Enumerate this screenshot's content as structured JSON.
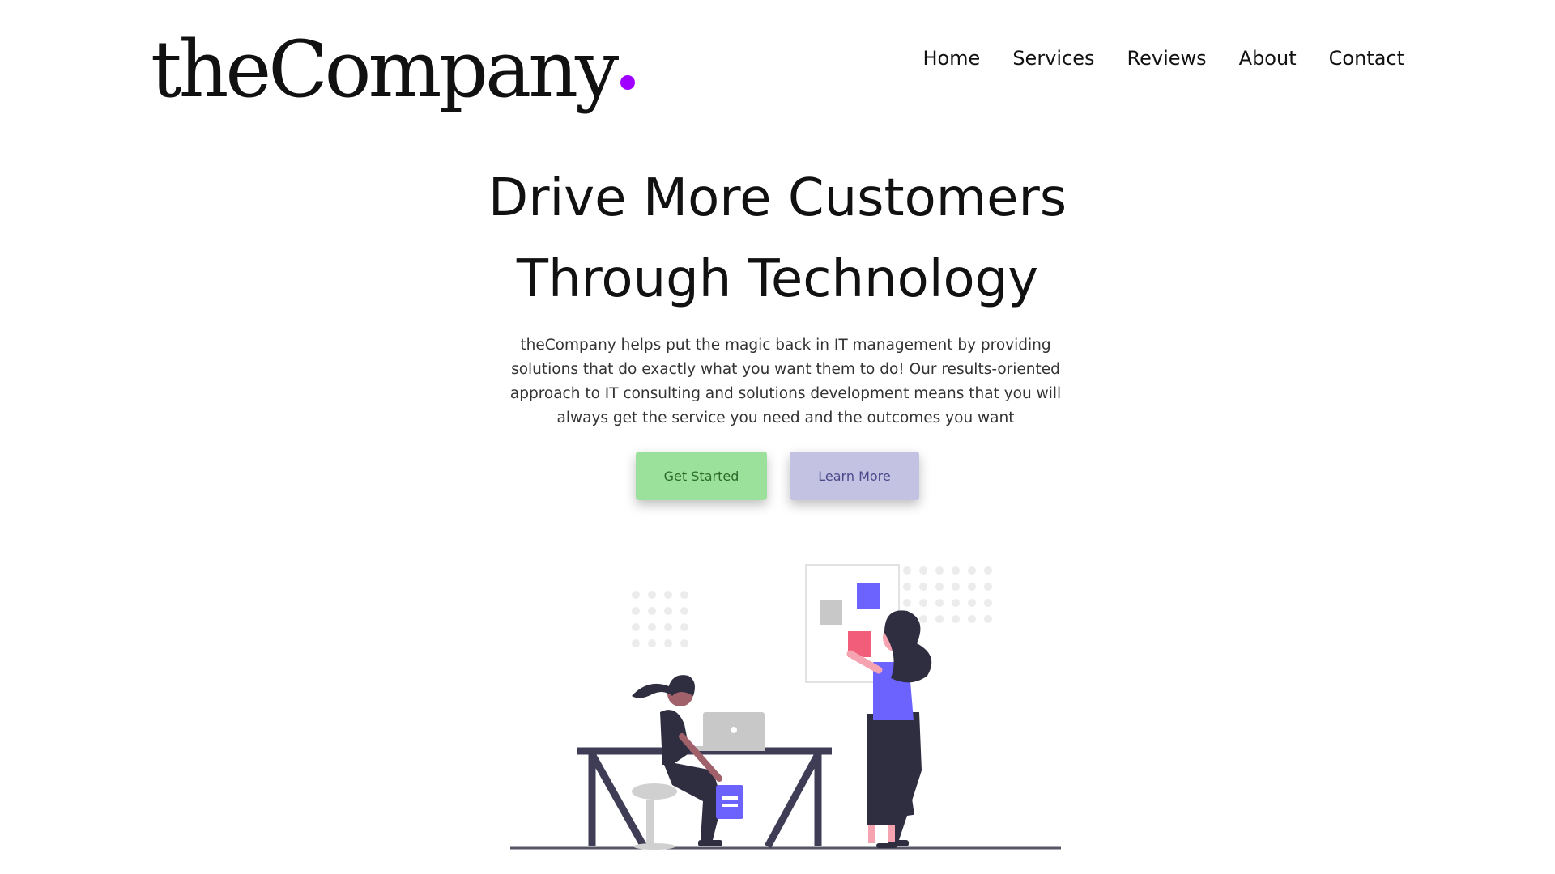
{
  "brand": {
    "name": "theCompany",
    "dot_color": "#a000ff"
  },
  "nav": {
    "items": [
      "Home",
      "Services",
      "Reviews",
      "About",
      "Contact"
    ]
  },
  "hero": {
    "title_line1": "Drive More Customers",
    "title_line2": "Through Technology",
    "description": "theCompany helps put the magic back in IT management by providing solutions that do exactly what you want them to do! Our results-oriented approach to IT consulting and solutions development means that you will always get the service you need and the outcomes you want",
    "primary_button": "Get Started",
    "secondary_button": "Learn More"
  },
  "colors": {
    "accent_purple": "#6c63ff",
    "accent_pink": "#f25e7a",
    "primary_green": "#9be09b",
    "secondary_lavender": "#c4c2e3"
  }
}
